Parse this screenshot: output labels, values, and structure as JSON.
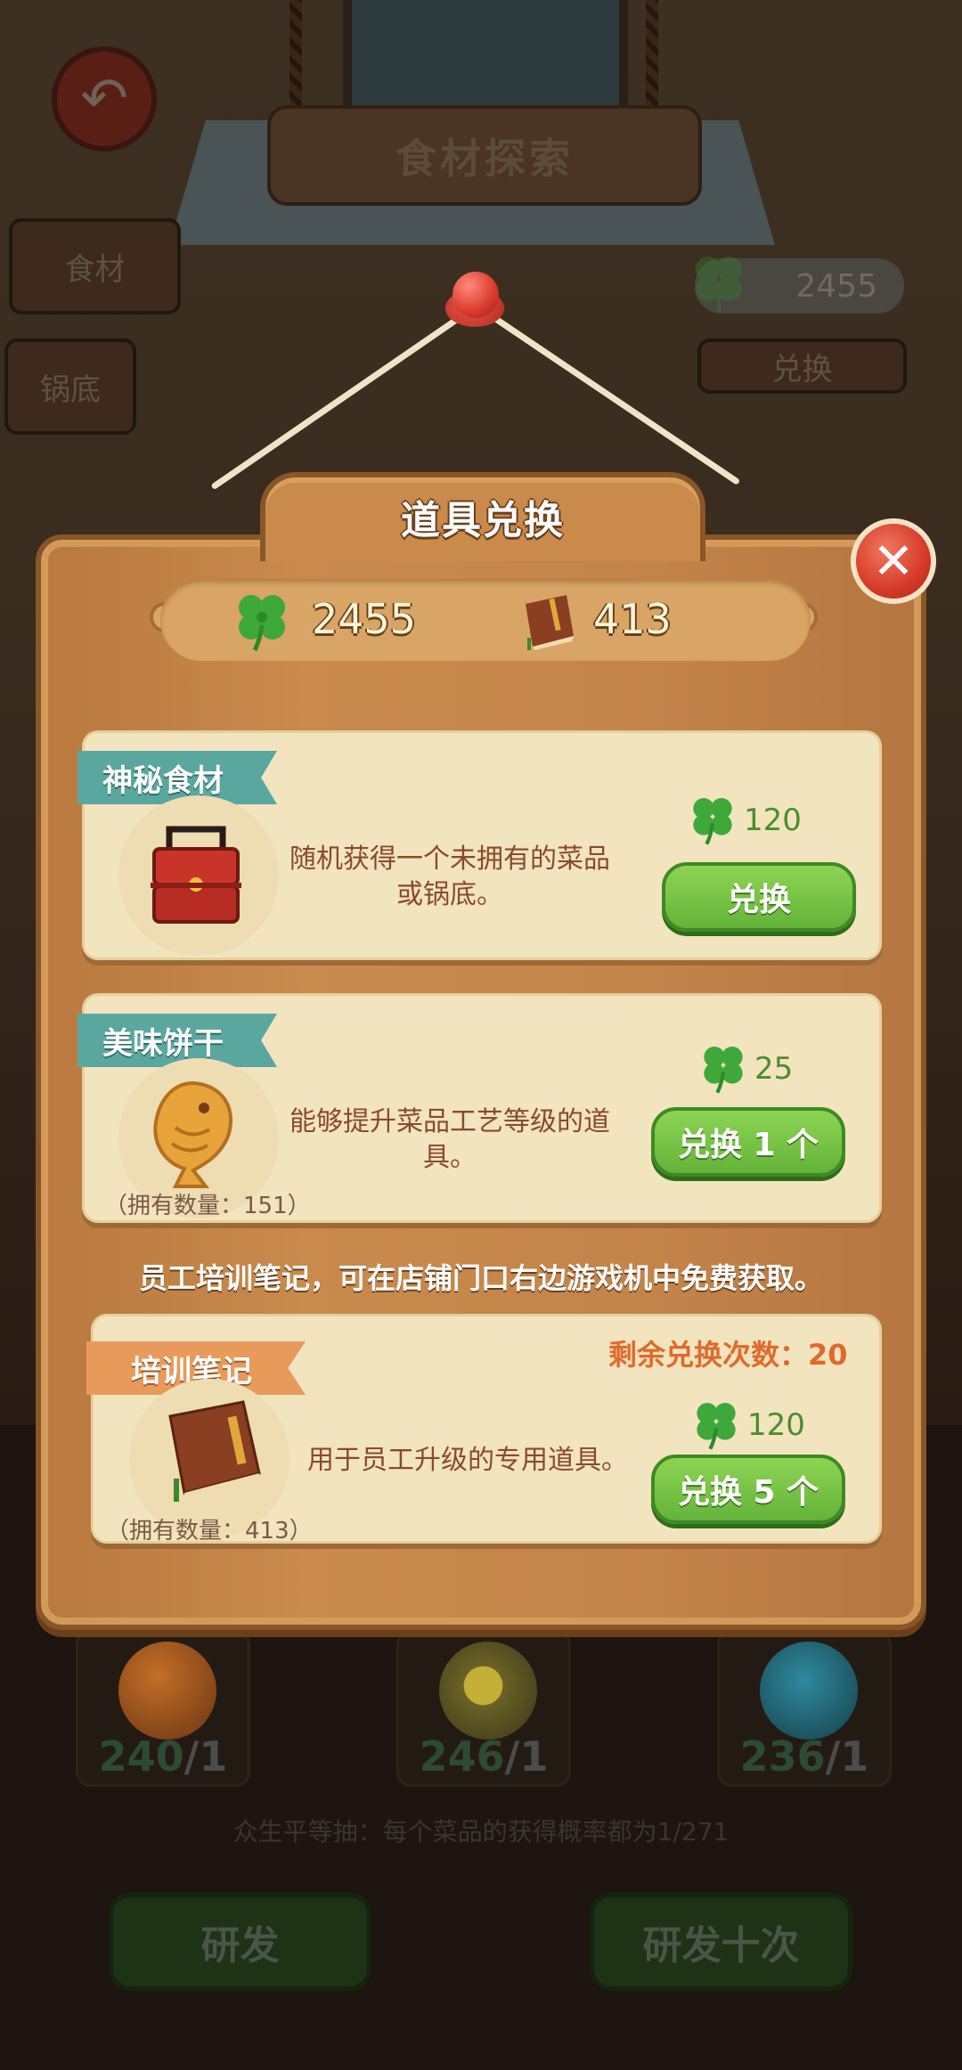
{
  "background": {
    "title": "食材探索",
    "tabs": [
      "食材",
      "锅底"
    ],
    "clover_count": "2455",
    "exchange_label": "兑换",
    "orbs": [
      {
        "count": "240",
        "total": "/1",
        "color": "#b8631f"
      },
      {
        "count": "246",
        "total": "/1",
        "color": "#b3a033"
      },
      {
        "count": "236",
        "total": "/1",
        "color": "#2a7a8a"
      }
    ],
    "note": "众生平等抽：每个菜品的获得概率都为1/271",
    "buttons": [
      "研发",
      "研发十次"
    ]
  },
  "modal": {
    "title": "道具兑换",
    "close_icon": "close-icon",
    "currency": {
      "clover": "2455",
      "book": "413"
    },
    "items": [
      {
        "ribbon": "神秘食材",
        "icon": "lunchbox-icon",
        "description": "随机获得一个未拥有的菜品或锅底。",
        "price": "120",
        "button": "兑换"
      },
      {
        "ribbon": "美味饼干",
        "icon": "fish-cookie-icon",
        "description": "能够提升菜品工艺等级的道具。",
        "owned": "（拥有数量：151）",
        "price": "25",
        "button": "兑换 1 个"
      },
      {
        "ribbon": "培训笔记",
        "icon": "notebook-icon",
        "description": "用于员工升级的专用道具。",
        "owned": "（拥有数量：413）",
        "remaining": "剩余兑换次数：20",
        "price": "120",
        "button": "兑换 5 个"
      }
    ],
    "notice": "员工培训笔记，可在店铺门口右边游戏机中免费获取。"
  }
}
